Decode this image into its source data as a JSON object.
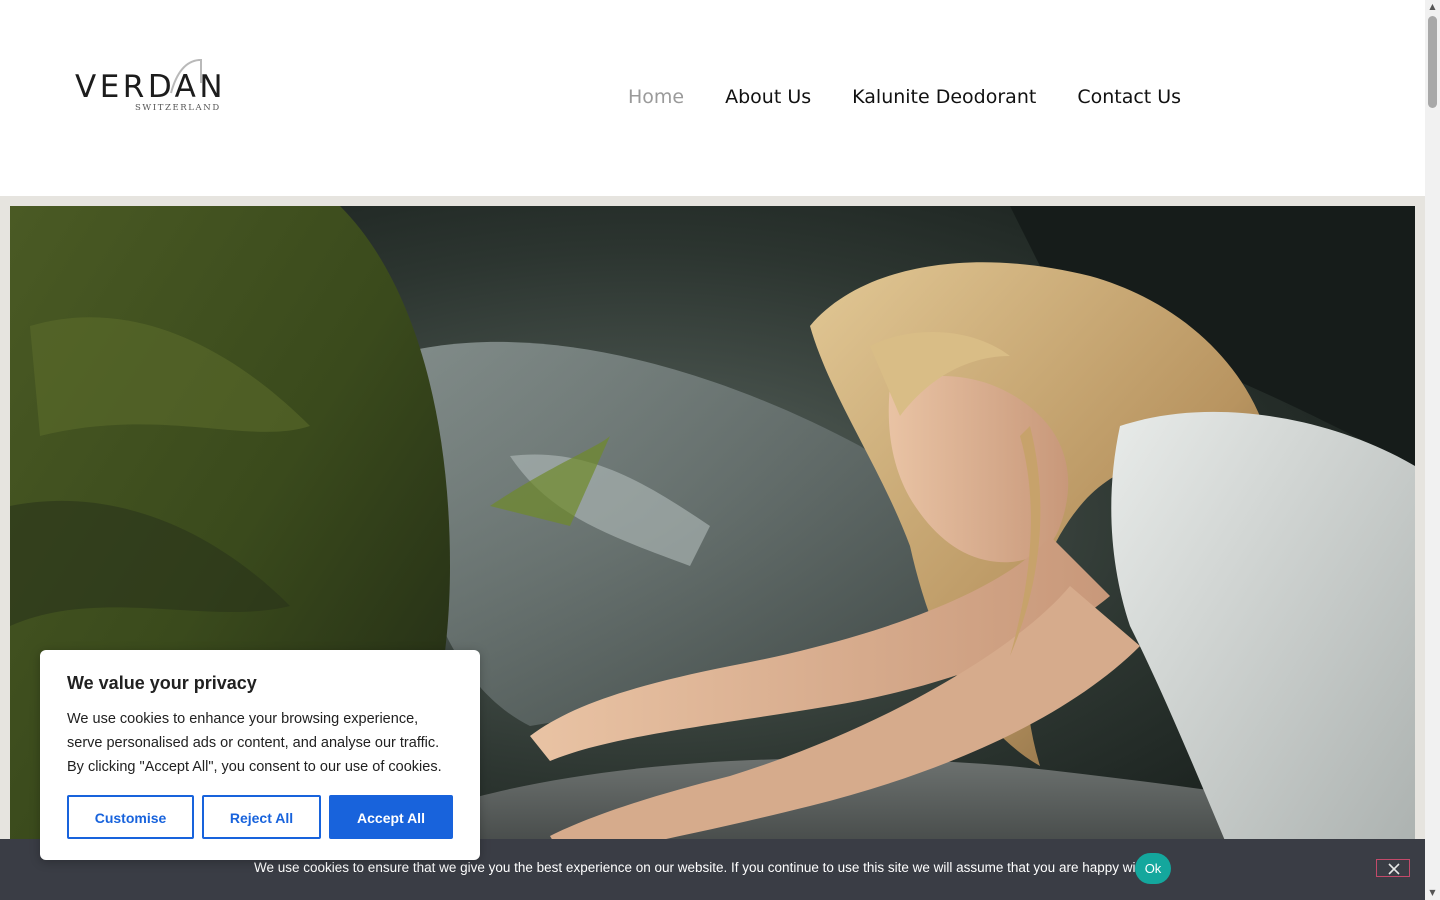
{
  "header": {
    "logo": {
      "wordmark": "VERDAN",
      "tagline": "SWITZERLAND"
    },
    "nav": [
      {
        "label": "Home",
        "active": true
      },
      {
        "label": "About Us",
        "active": false
      },
      {
        "label": "Kalunite Deodorant",
        "active": false
      },
      {
        "label": "Contact Us",
        "active": false
      }
    ]
  },
  "hero": {
    "image": "woman-leaning-on-mossy-rocks-photo"
  },
  "privacy_modal": {
    "title": "We value your privacy",
    "body": "We use cookies to enhance your browsing experience, serve personalised ads or content, and analyse our traffic. By clicking \"Accept All\", you consent to our use of cookies.",
    "buttons": {
      "customise": "Customise",
      "reject": "Reject All",
      "accept": "Accept All"
    },
    "accent_color": "#1863dc"
  },
  "cookie_bar": {
    "text": "We use cookies to ensure that we give you the best experience on our website. If you continue to use this site we will assume that you are happy with it.",
    "ok_label": "Ok",
    "close_icon": "close-icon",
    "ok_color": "#14a79d",
    "background": "#3a3d45"
  }
}
